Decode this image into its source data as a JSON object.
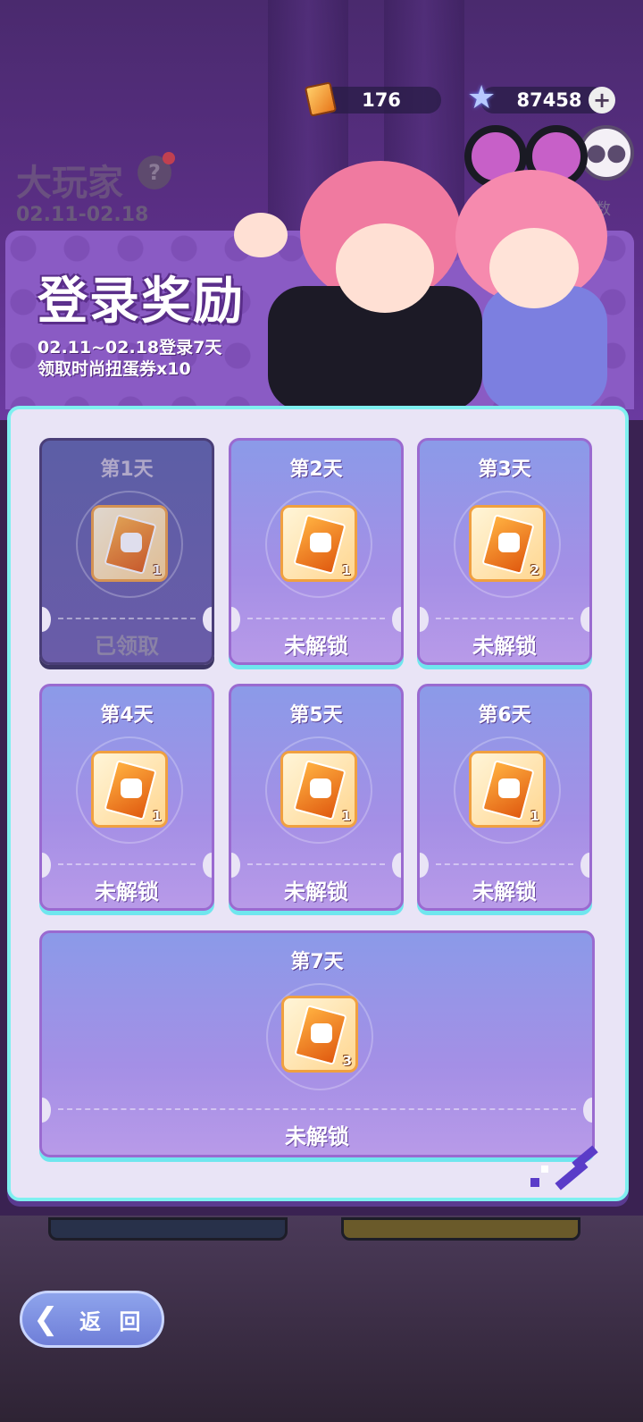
{
  "currency": {
    "tickets": "176",
    "gems": "87458",
    "ticket_icon": "gacha-ticket-icon",
    "gem_icon": "star-gem-icon"
  },
  "background": {
    "title": "大玩家",
    "date": "02.11-02.18",
    "side_text": "数"
  },
  "banner": {
    "title": "登录奖励",
    "line1": "02.11~02.18登录7天",
    "line2": "领取时尚扭蛋券x10"
  },
  "days": [
    {
      "label": "第1天",
      "qty": "1",
      "status": "已领取",
      "claimed": true
    },
    {
      "label": "第2天",
      "qty": "1",
      "status": "未解锁",
      "claimed": false
    },
    {
      "label": "第3天",
      "qty": "2",
      "status": "未解锁",
      "claimed": false
    },
    {
      "label": "第4天",
      "qty": "1",
      "status": "未解锁",
      "claimed": false
    },
    {
      "label": "第5天",
      "qty": "1",
      "status": "未解锁",
      "claimed": false
    },
    {
      "label": "第6天",
      "qty": "1",
      "status": "未解锁",
      "claimed": false
    },
    {
      "label": "第7天",
      "qty": "3",
      "status": "未解锁",
      "claimed": false
    }
  ],
  "back_button": {
    "label": "返 回"
  },
  "colors": {
    "accent": "#7ff0f0",
    "card": "#9a8ce6",
    "banner": "#8a5bc4"
  }
}
